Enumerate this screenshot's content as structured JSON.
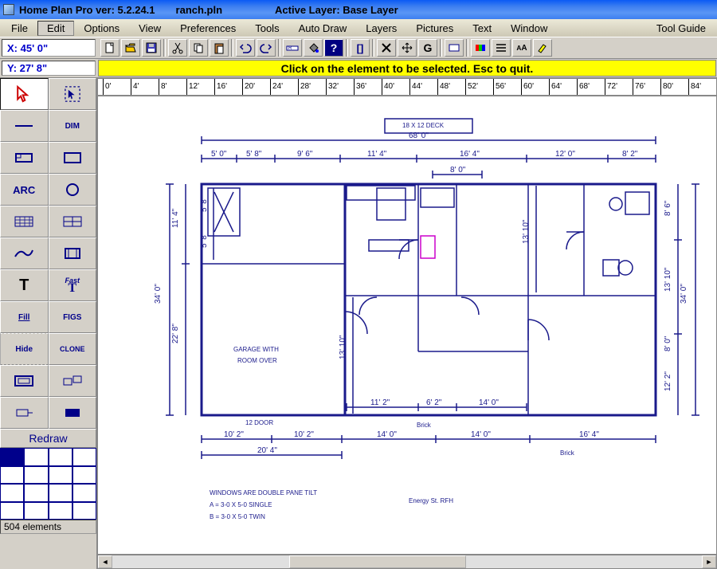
{
  "title": {
    "app": "Home Plan Pro ver: 5.2.24.1",
    "file": "ranch.pln",
    "layer_label": "Active Layer: Base Layer"
  },
  "menu": [
    "File",
    "Edit",
    "Options",
    "View",
    "Preferences",
    "Tools",
    "Auto Draw",
    "Layers",
    "Pictures",
    "Text",
    "Window",
    "Tool Guide"
  ],
  "coords": {
    "x": "X: 45' 0\"",
    "y": "Y: 27' 8\""
  },
  "toolbar_icons": [
    "new",
    "open",
    "save",
    "cut",
    "copy",
    "paste",
    "undo",
    "redo",
    "ruler",
    "fill",
    "help",
    "bold",
    "delete",
    "pan",
    "rotate",
    "info",
    "swatch",
    "list",
    "font",
    "highlight"
  ],
  "hint": "Click on the element to be selected.  Esc to quit.",
  "ruler_ticks": [
    "0'",
    "4'",
    "8'",
    "12'",
    "16'",
    "20'",
    "24'",
    "28'",
    "32'",
    "36'",
    "40'",
    "44'",
    "48'",
    "52'",
    "56'",
    "60'",
    "64'",
    "68'",
    "72'",
    "76'",
    "80'",
    "84'"
  ],
  "palette": {
    "tools": [
      "pointer",
      "marquee",
      "line",
      "dim",
      "rect",
      "hollow",
      "arc",
      "circle",
      "pattern",
      "grid",
      "curve",
      "door",
      "text",
      "fasttext",
      "fill",
      "figs",
      "hide",
      "clone",
      "hollowrect",
      "group",
      "flag",
      "solid"
    ],
    "labels": {
      "dim": "DIM",
      "arc": "ARC",
      "text": "T",
      "fasttext": "Fast\nT",
      "fill": "Fill",
      "figs": "FIGS",
      "hide": "Hide",
      "clone": "CLONE"
    },
    "redraw": "Redraw",
    "status": "504 elements"
  },
  "plan": {
    "overall_width": "68' 0\"",
    "deck": "18 X 12 DECK",
    "top_dims": [
      "5' 0\"",
      "5' 8\"",
      "9' 6\"",
      "11' 4\"",
      "16' 4\"",
      "12' 0\"",
      "8' 2\""
    ],
    "top_sub": "8' 0\"",
    "left_height": "34' 0\"",
    "left_inner": [
      "11' 4\"",
      "22' 8\""
    ],
    "left_inner2": [
      "5' 8\"",
      "5' 8\""
    ],
    "right_height": "34' 0\"",
    "right_inner": [
      "8' 6\"",
      "13' 10\""
    ],
    "right_bottom": [
      "8' 0\"",
      "12' 2\""
    ],
    "mid_heights": [
      "13' 10\""
    ],
    "bottom_dims": [
      "10' 2\"",
      "10' 2\"",
      "14' 0\"",
      "14' 0\"",
      "16' 4\""
    ],
    "bottom_span": "20' 4\"",
    "interior_dims": [
      "11' 2\"",
      "6' 2\"",
      "14' 0\""
    ],
    "garage_text1": "GARAGE WITH",
    "garage_text2": "ROOM OVER",
    "door1": "12 DOOR",
    "notes1": "WINDOWS ARE DOUBLE PANE TILT",
    "notes2": "A = 3-0 X 5-0 SINGLE",
    "notes3": "B = 3-0 X 5-0 TWIN",
    "brick": "Brick",
    "ratings": "Energy St. RFH"
  }
}
